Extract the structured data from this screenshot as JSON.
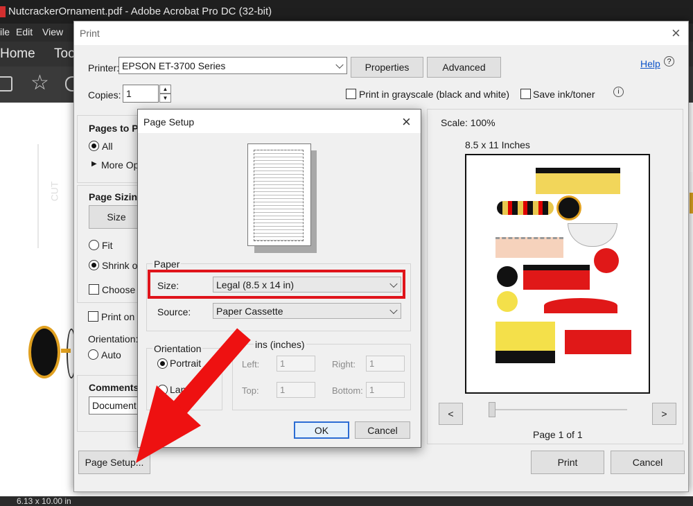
{
  "acrobat": {
    "window_title": "NutcrackerOrnament.pdf - Adobe Acrobat Pro DC (32-bit)",
    "menu": [
      "ile",
      "Edit",
      "View"
    ],
    "tabs": [
      "Home",
      "Too"
    ],
    "status_size": "6.13 x 10.00 in"
  },
  "print": {
    "title": "Print",
    "printer_label": "Printer:",
    "printer_value": "EPSON ET-3700 Series",
    "properties_label": "Properties",
    "advanced_label": "Advanced",
    "help_label": "Help",
    "copies_label": "Copies:",
    "copies_value": "1",
    "grayscale_label": "Print in grayscale (black and white)",
    "save_ink_label": "Save ink/toner",
    "pages_to_print": "Pages to Pr",
    "all_label": "All",
    "more_options": "More Op",
    "page_sizing": "Page Sizing",
    "size_button": "Size",
    "fit_label": "Fit",
    "shrink_label": "Shrink ov",
    "choose_label": "Choose p",
    "print_on_label": "Print on",
    "orientation_label": "Orientation:",
    "auto_label": "Auto",
    "comments_label": "Comments",
    "comments_value": "Document",
    "scale_label": "Scale: 100%",
    "paper_size_label": "8.5 x 11 Inches",
    "page_of": "Page 1 of 1",
    "prev_label": "<",
    "next_label": ">",
    "page_setup_button": "Page Setup...",
    "print_button": "Print",
    "cancel_button": "Cancel"
  },
  "setup": {
    "title": "Page Setup",
    "paper_group": "Paper",
    "size_label": "Size:",
    "size_value": "Legal (8.5 x 14 in)",
    "source_label": "Source:",
    "source_value": "Paper Cassette",
    "orientation_group": "Orientation",
    "portrait_label": "Portrait",
    "landscape_label": "Lands",
    "margins_group": "ins (inches)",
    "left_label": "Left:",
    "left_value": "1",
    "right_label": "Right:",
    "right_value": "1",
    "top_label": "Top:",
    "top_value": "1",
    "bottom_label": "Bottom:",
    "bottom_value": "1",
    "ok_label": "OK",
    "cancel_label": "Cancel"
  },
  "colors": {
    "highlight": "#e0141b",
    "arrow": "#ee1111",
    "link": "#0b52c8"
  }
}
